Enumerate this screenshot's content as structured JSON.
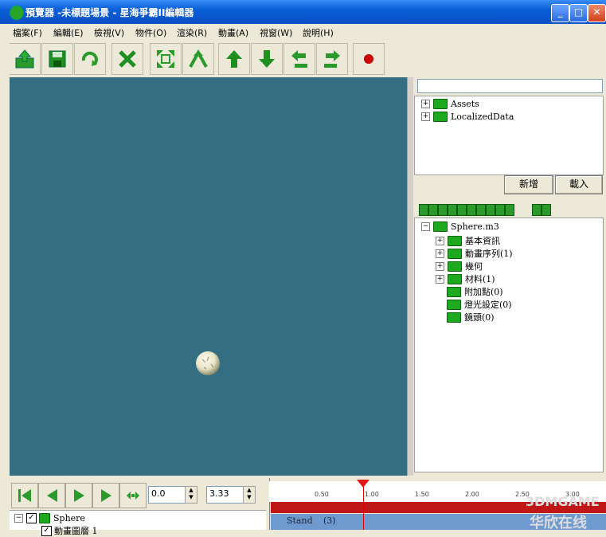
{
  "window": {
    "title": "預覽器 -未標題場景 - 星海爭霸II編輯器",
    "minimize": "_",
    "maximize": "□",
    "close": "✕"
  },
  "menu": [
    "檔案(F)",
    "編輯(E)",
    "檢視(V)",
    "物件(O)",
    "渲染(R)",
    "動畫(A)",
    "視窗(W)",
    "說明(H)"
  ],
  "toolbar": {
    "icons": [
      "open-icon",
      "save-icon",
      "refresh-icon",
      "delete-icon",
      "fit-view-icon",
      "pan-icon",
      "move-up-icon",
      "move-down-icon",
      "rotate-left-icon",
      "rotate-right-icon",
      "record-icon"
    ]
  },
  "right_panel": {
    "search_value": "",
    "tree1": [
      {
        "label": "Assets",
        "expander": "+"
      },
      {
        "label": "LocalizedData",
        "expander": "+"
      }
    ],
    "add_button": "新增",
    "load_button": "載入",
    "tree2": {
      "root": {
        "label": "Sphere.m3",
        "expander": "−"
      },
      "children": [
        {
          "label": "基本資訊",
          "expander": "+"
        },
        {
          "label": "動畫序列(1)",
          "expander": "+"
        },
        {
          "label": "幾何",
          "expander": "+"
        },
        {
          "label": "材料(1)",
          "expander": "+"
        },
        {
          "label": "附加點(0)",
          "expander": ""
        },
        {
          "label": "燈光設定(0)",
          "expander": ""
        },
        {
          "label": "鏡頭(0)",
          "expander": ""
        }
      ]
    }
  },
  "playback": {
    "start_time": "0.0",
    "end_time": "3.33"
  },
  "layers": {
    "root": "Sphere",
    "root_expander": "−",
    "child": "動畫圖層 1"
  },
  "timeline": {
    "ticks": [
      "0.50",
      "1.00",
      "1.50",
      "2.00",
      "2.50",
      "3.00"
    ],
    "sequence_name": "Stand",
    "sequence_count": "(3)"
  },
  "watermark": {
    "line1": "3DMGAME",
    "line2": "华欣在线"
  },
  "colors": {
    "viewport": "#356d82",
    "timeline_track": "#c01818",
    "sequence_bar": "#6f9ad0"
  }
}
